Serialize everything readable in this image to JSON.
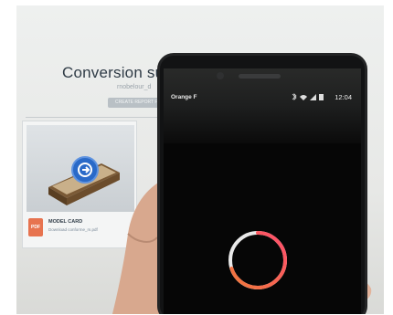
{
  "background_page": {
    "title": "Conversion suc",
    "subtitle": "rnobelour_d",
    "button_label": "CREATE REPORT FOR",
    "card": {
      "title": "MODEL CARD",
      "download_text": "Download conforme_m.pdf",
      "pdf_label": "PDF"
    }
  },
  "phone": {
    "carrier": "Orange F",
    "time": "12:04",
    "status_icons": [
      "bluetooth-icon",
      "wifi-icon",
      "signal-icon",
      "battery-icon"
    ],
    "spinner": {
      "progress": 0.7,
      "colors": {
        "track": "#e9e9e9",
        "arc_start": "#f07a3a",
        "arc_end": "#ff4d6d"
      }
    }
  },
  "colors": {
    "accent_blue": "#2a6ac8",
    "monitor_bg": "#eef0ef",
    "phone_body": "#121314"
  }
}
